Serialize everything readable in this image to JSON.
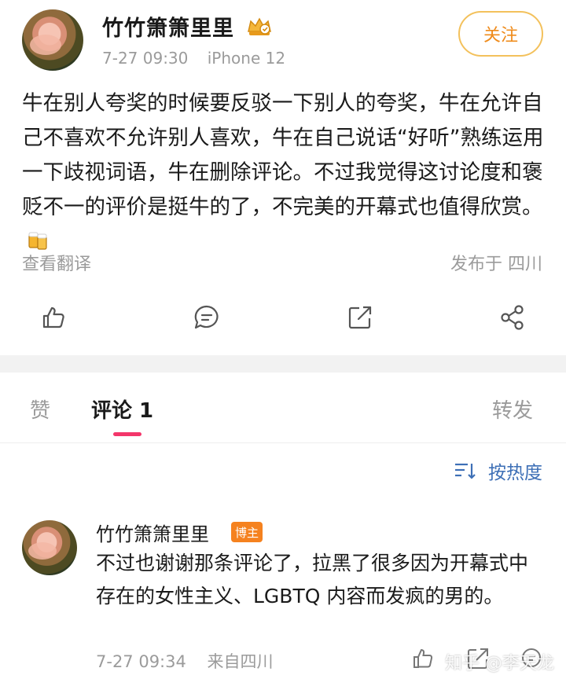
{
  "post": {
    "author": "竹竹箫箫里里",
    "time": "7-27 09:30",
    "device": "iPhone 12",
    "follow_label": "关注",
    "text": "牛在别人夸奖的时候要反驳一下别人的夸奖，牛在允许自己不喜欢不允许别人喜欢，牛在自己说话“好听”熟练运用一下歧视词语，牛在删除评论。不过我觉得这讨论度和褒贬不一的评价是挺牛的了，不完美的开幕式也值得欣赏。",
    "translate_label": "查看翻译",
    "location": "发布于 四川"
  },
  "actions": {
    "icons": [
      "like-icon",
      "comment-icon",
      "share-icon",
      "more-share-icon"
    ]
  },
  "tabs": {
    "likes": "赞",
    "comments": "评论 1",
    "reposts": "转发"
  },
  "sort": {
    "label": "按热度"
  },
  "comment": {
    "author": "竹竹箫箫里里",
    "badge": "博主",
    "text": "不过也谢谢那条评论了，拉黑了很多因为开幕式中存在的女性主义、LGBTQ 内容而发疯的男的。",
    "time": "7-27 09:34",
    "source": "来自四川"
  },
  "watermark": "知乎 @李天龙",
  "colors": {
    "accent_orange": "#ef8b1b",
    "follow_border": "#f3c15c",
    "tab_indicator": "#f3366a",
    "sort_blue": "#3d6fb6",
    "badge_orange": "#f5821f"
  }
}
